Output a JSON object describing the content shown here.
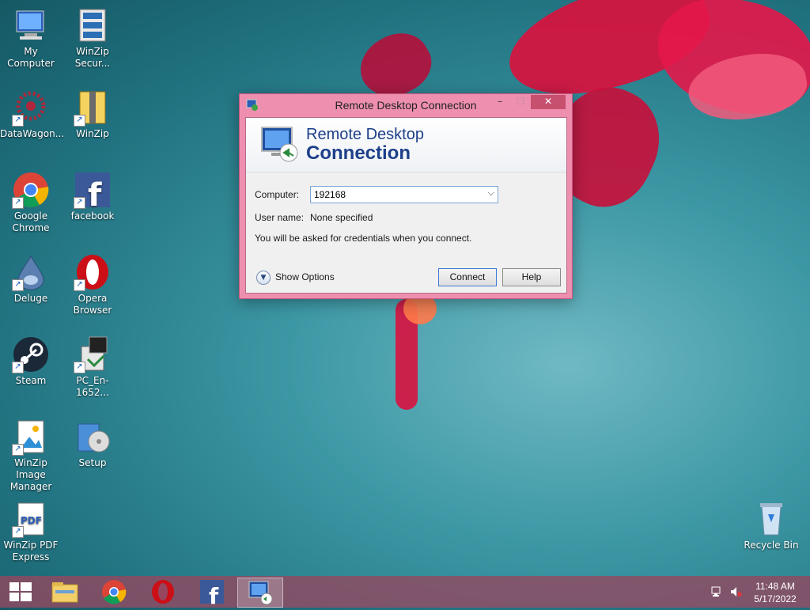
{
  "desktop": {
    "icons": [
      {
        "label": "My Computer"
      },
      {
        "label": "WinZip Secur..."
      },
      {
        "label": "DataWagon..."
      },
      {
        "label": "WinZip"
      },
      {
        "label": "Google Chrome"
      },
      {
        "label": "facebook"
      },
      {
        "label": "Deluge"
      },
      {
        "label": "Opera Browser"
      },
      {
        "label": "Steam"
      },
      {
        "label": "PC_En-1652..."
      },
      {
        "label": "WinZip Image Manager"
      },
      {
        "label": "Setup"
      },
      {
        "label": "WinZip PDF Express"
      },
      {
        "label": "Recycle Bin"
      }
    ]
  },
  "dialog": {
    "title": "Remote Desktop Connection",
    "banner_line1": "Remote Desktop",
    "banner_line2": "Connection",
    "computer_label": "Computer:",
    "computer_value": "192168",
    "username_label": "User name:",
    "username_value": "None specified",
    "info_text": "You will be asked for credentials when you connect.",
    "show_options": "Show Options",
    "connect": "Connect",
    "help": "Help",
    "minimize_glyph": "–",
    "maximize_glyph": "☐",
    "close_glyph": "✕"
  },
  "taskbar": {
    "time": "11:48 AM",
    "date": "5/17/2022",
    "items": [
      "start",
      "file-explorer",
      "chrome",
      "opera",
      "facebook",
      "remote-desktop"
    ]
  },
  "colors": {
    "dialog_frame": "#ee8fb0",
    "banner_text": "#1d3f8a",
    "taskbar": "#96465f"
  }
}
